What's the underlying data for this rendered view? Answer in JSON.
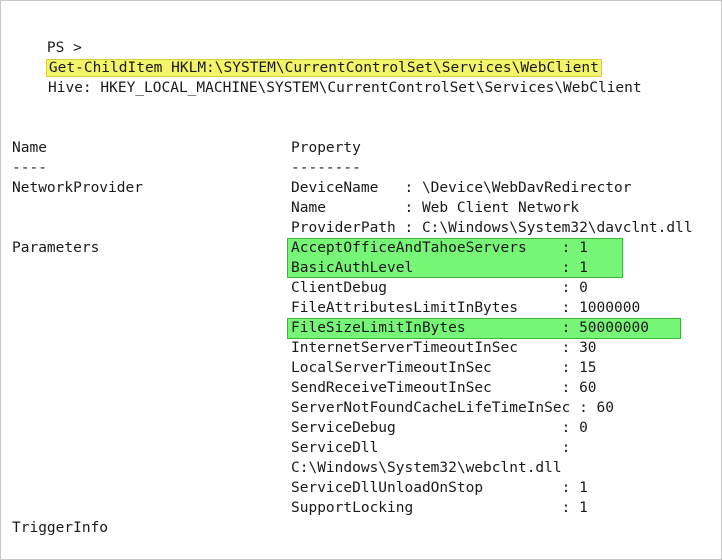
{
  "console": {
    "prompt": "PS >",
    "command": "Get-ChildItem HKLM:\\SYSTEM\\CurrentControlSet\\Services\\WebClient",
    "hive_line": "Hive: HKEY_LOCAL_MACHINE\\SYSTEM\\CurrentControlSet\\Services\\WebClient"
  },
  "headers": {
    "name": "Name",
    "name_rule": "----",
    "property": "Property",
    "property_rule": "--------"
  },
  "entries": [
    {
      "name": "NetworkProvider",
      "properties": [
        "DeviceName   : \\Device\\WebDavRedirector",
        "Name         : Web Client Network",
        "ProviderPath : C:\\Windows\\System32\\davclnt.dll"
      ]
    },
    {
      "name": "Parameters",
      "properties": [
        "AcceptOfficeAndTahoeServers    : 1",
        "BasicAuthLevel                 : 1",
        "ClientDebug                    : 0",
        "FileAttributesLimitInBytes     : 1000000",
        "FileSizeLimitInBytes           : 50000000",
        "InternetServerTimeoutInSec     : 30",
        "LocalServerTimeoutInSec        : 15",
        "SendReceiveTimeoutInSec        : 60",
        "ServerNotFoundCacheLifeTimeInSec : 60",
        "ServiceDebug                   : 0",
        "ServiceDll                     :",
        "C:\\Windows\\System32\\webclnt.dll",
        "ServiceDllUnloadOnStop         : 1",
        "SupportLocking                 : 1"
      ]
    },
    {
      "name": "TriggerInfo",
      "properties": []
    }
  ],
  "colors": {
    "command_highlight": "#f4f46a",
    "property_highlight": "#76f576"
  }
}
